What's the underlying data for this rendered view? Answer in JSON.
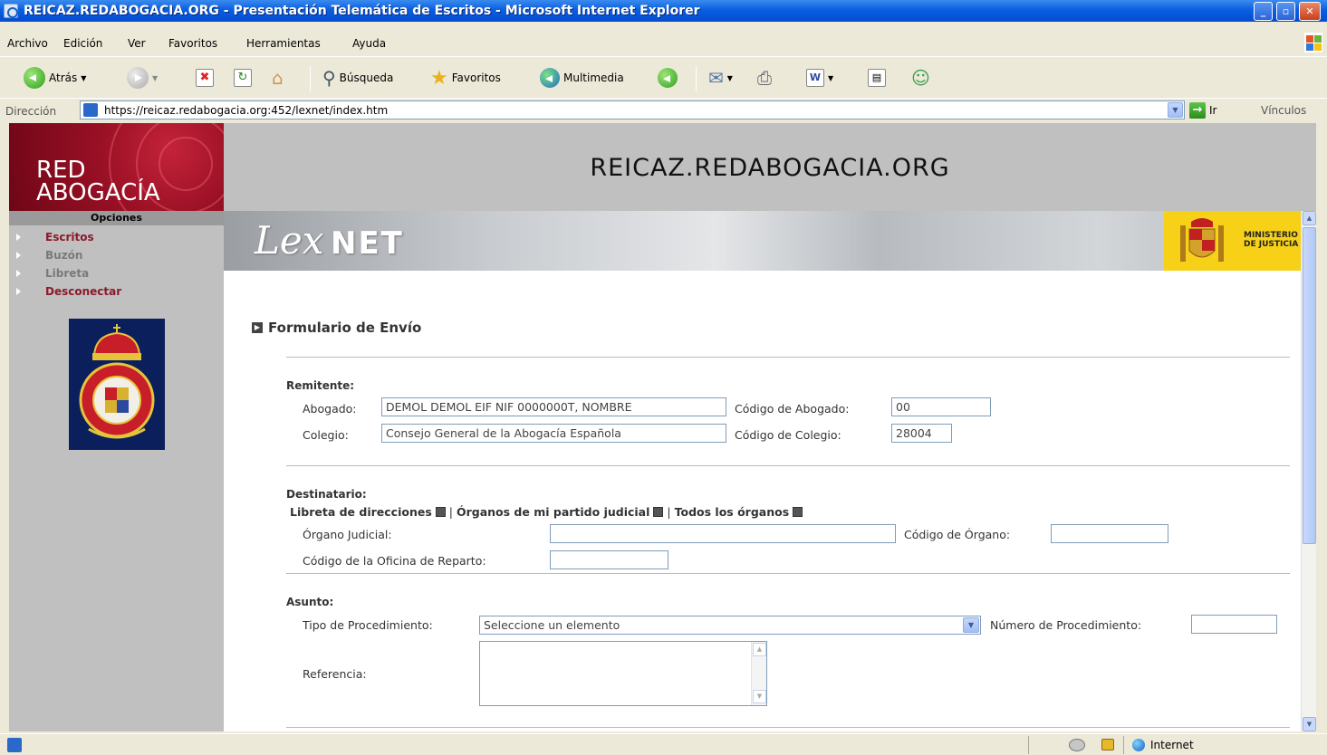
{
  "window": {
    "title": "REICAZ.REDABOGACIA.ORG - Presentación Telemática de Escritos - Microsoft Internet Explorer"
  },
  "menu": [
    "Archivo",
    "Edición",
    "Ver",
    "Favoritos",
    "Herramientas",
    "Ayuda"
  ],
  "toolbar": {
    "back": "Atrás",
    "search": "Búsqueda",
    "favorites": "Favoritos",
    "media": "Multimedia"
  },
  "address": {
    "label": "Dirección",
    "url": "https://reicaz.redabogacia.org:452/lexnet/index.htm",
    "go": "Ir",
    "links": "Vínculos"
  },
  "site": {
    "logo_line1": "RED",
    "logo_line2": "ABOGACÍA",
    "header_title": "REICAZ.REDABOGACIA.ORG",
    "lex_part": "Lex",
    "net_part": "NET",
    "ministry_line1": "MINISTERIO",
    "ministry_line2": "DE JUSTICIA"
  },
  "sidebar": {
    "header": "Opciones",
    "items": [
      {
        "label": "Escritos",
        "color": "#8B1A2B"
      },
      {
        "label": "Buzón",
        "color": "#7a7a7a"
      },
      {
        "label": "Libreta",
        "color": "#7a7a7a"
      },
      {
        "label": "Desconectar",
        "color": "#8B1A2B"
      }
    ]
  },
  "form": {
    "title": "Formulario de Envío",
    "remitente": {
      "section": "Remitente:",
      "abogado_label": "Abogado:",
      "abogado_value": "DEMOL DEMOL EIF NIF 0000000T, NOMBRE",
      "codigo_abogado_label": "Código de Abogado:",
      "codigo_abogado_value": "00",
      "colegio_label": "Colegio:",
      "colegio_value": "Consejo General de la Abogacía Española",
      "codigo_colegio_label": "Código de Colegio:",
      "codigo_colegio_value": "28004"
    },
    "destinatario": {
      "section": "Destinatario:",
      "link_libreta": "Libreta de direcciones",
      "link_organos_partido": "Órganos de mi partido judicial",
      "link_todos": "Todos los órganos",
      "separator": "|",
      "organo_label": "Órgano Judicial:",
      "organo_value": "",
      "codigo_organo_label": "Código de Órgano:",
      "codigo_organo_value": "",
      "oficina_label": "Código de la Oficina de Reparto:",
      "oficina_value": ""
    },
    "asunto": {
      "section": "Asunto:",
      "tipo_label": "Tipo de Procedimiento:",
      "tipo_value": "Seleccione un elemento",
      "numero_label": "Número de Procedimiento:",
      "numero_value": "",
      "referencia_label": "Referencia:"
    }
  },
  "status": {
    "zone": "Internet"
  }
}
